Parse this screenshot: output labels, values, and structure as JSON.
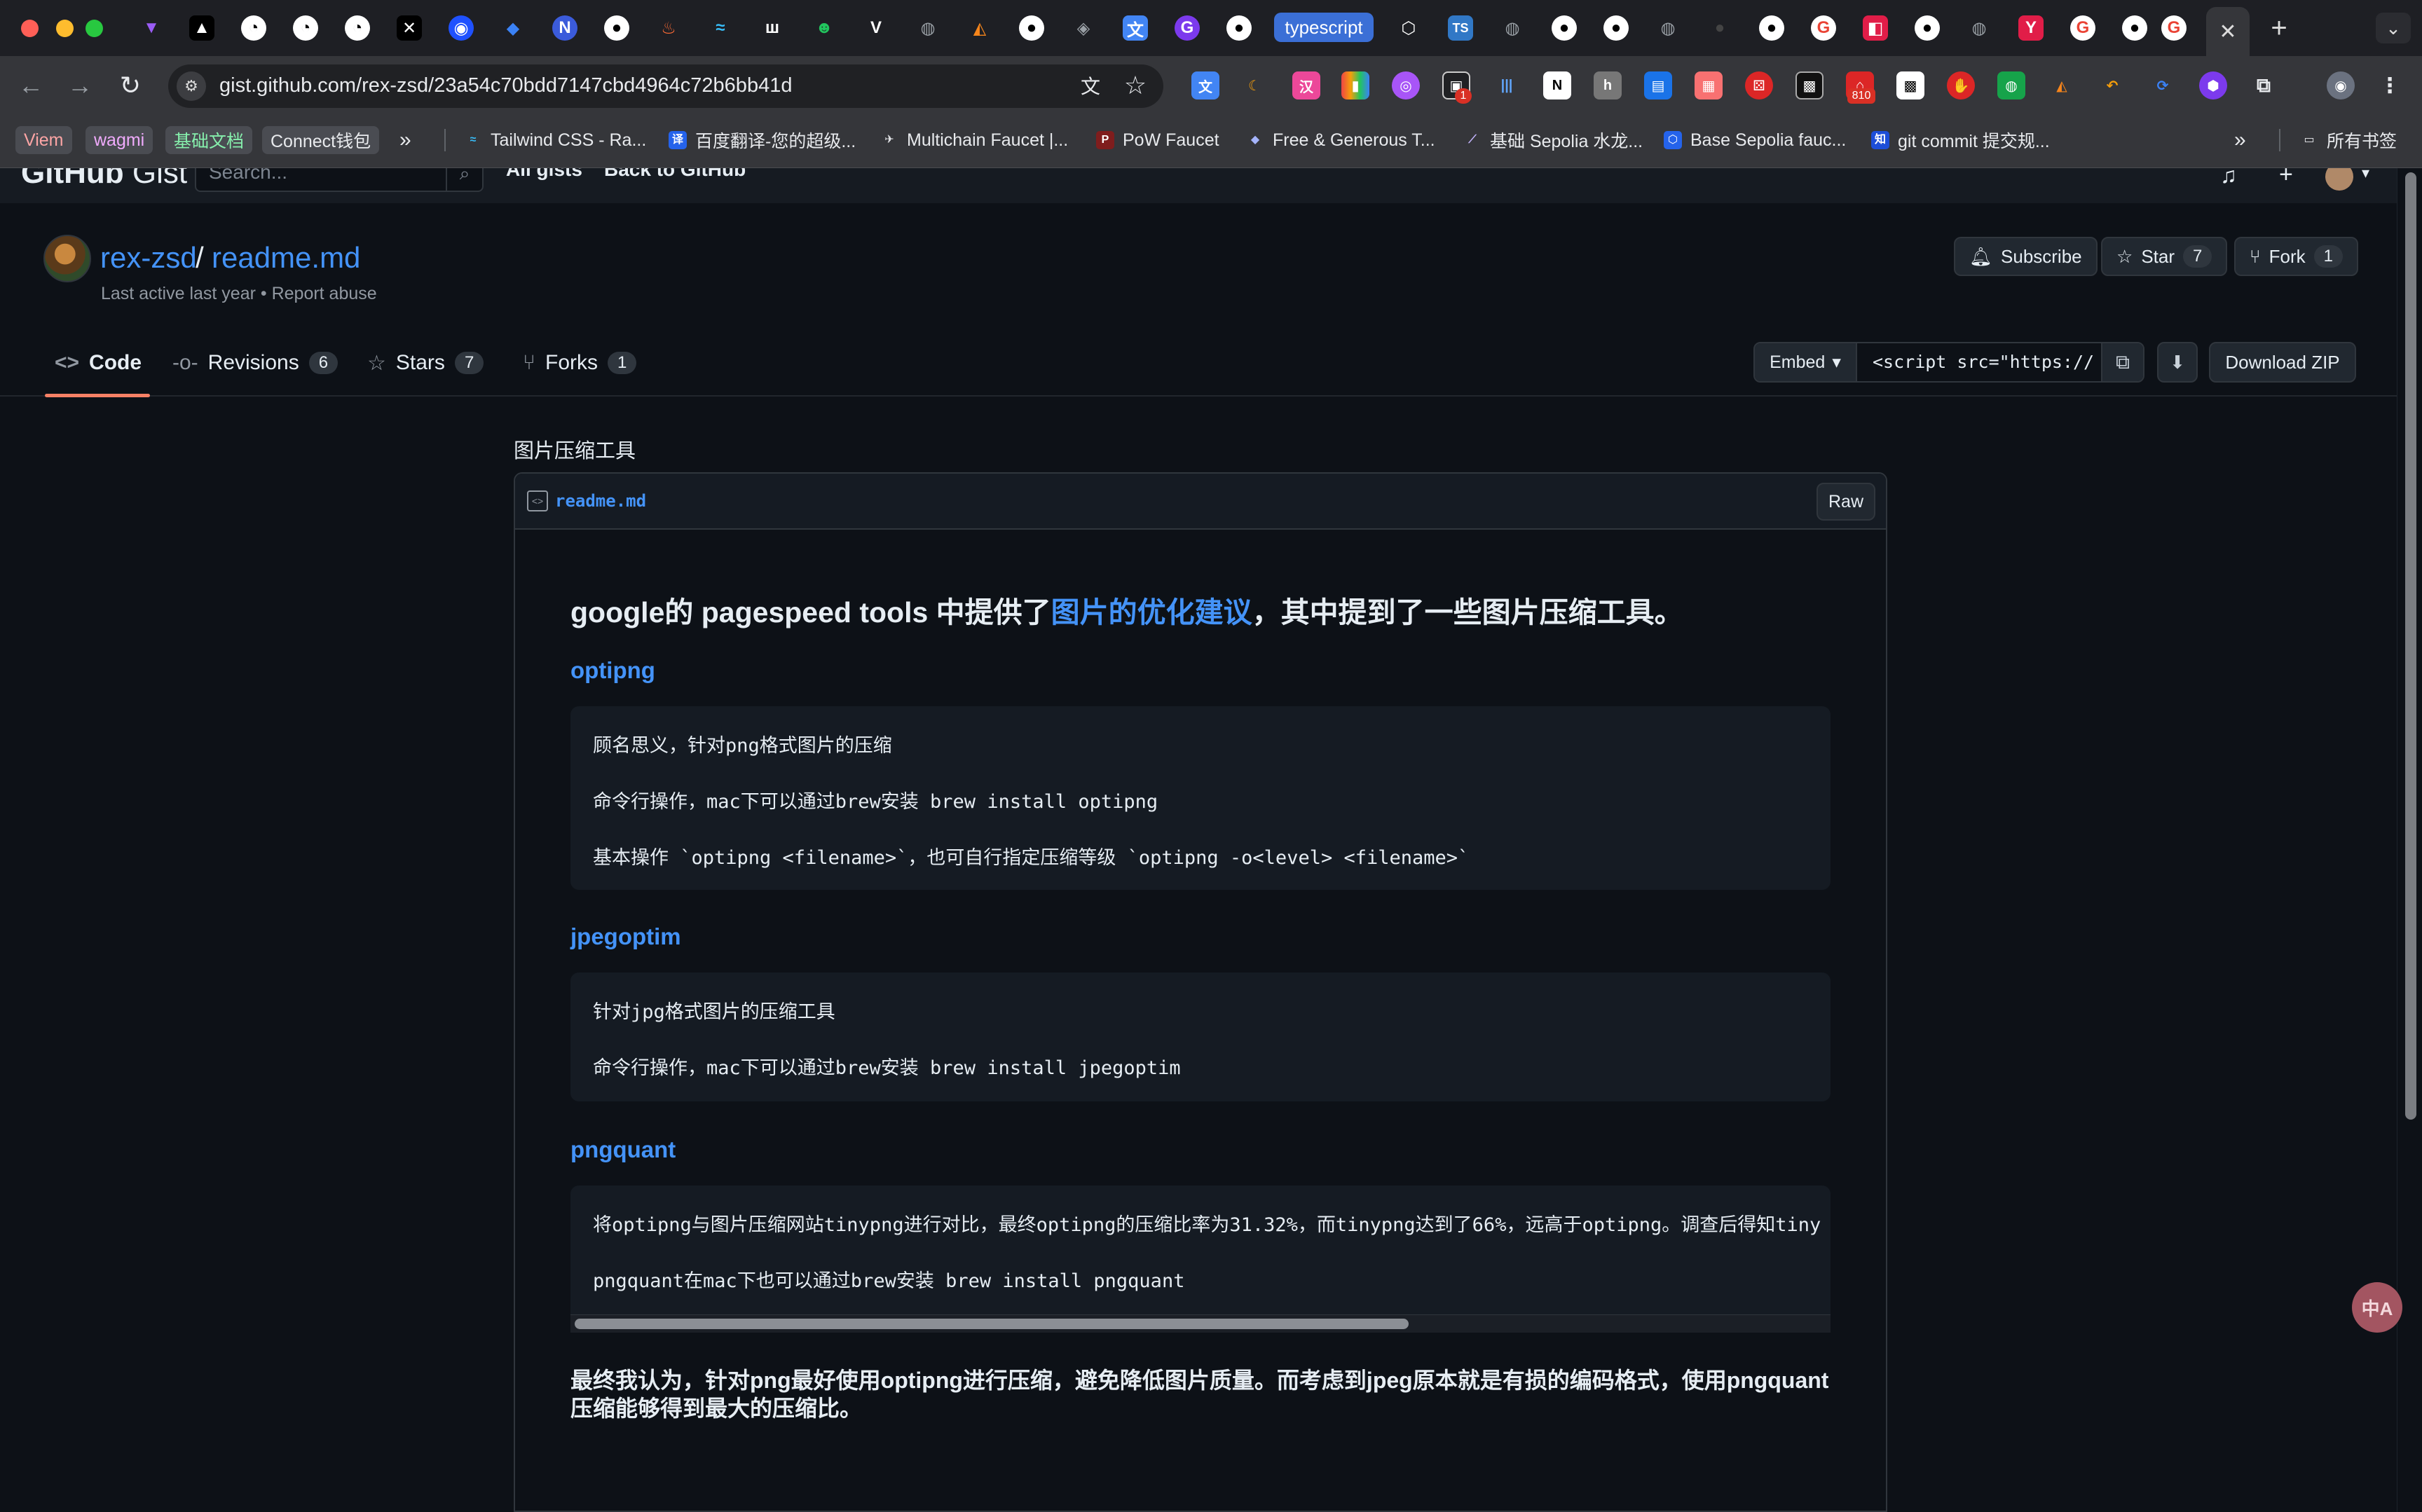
{
  "browser": {
    "pinned_tab_label": "typescript",
    "url": "gist.github.com/rex-zsd/23a54c70bdd7147cbd4964c72b6bb41d",
    "extension_badges": [
      "1",
      "810"
    ],
    "bookmarks": [
      "Viem",
      "wagmi",
      "基础文档",
      "Connect钱包",
      "Tailwind CSS - Ra...",
      "百度翻译-您的超级...",
      "Multichain Faucet |...",
      "PoW Faucet",
      "Free & Generous T...",
      "基础 Sepolia 水龙...",
      "Base Sepolia fauc...",
      "git commit 提交规..."
    ],
    "all_bookmarks_label": "所有书签"
  },
  "gist_header": {
    "logo_bold": "GitHub",
    "logo_light": "Gist",
    "search_placeholder": "Search...",
    "all_gists": "All gists",
    "back_to_github": "Back to GitHub"
  },
  "gist": {
    "owner": "rex-zsd",
    "separator": "/",
    "filename": "readme.md",
    "meta": "Last active last year • Report abuse",
    "subscribe": "Subscribe",
    "star": "Star",
    "star_count": "7",
    "fork": "Fork",
    "fork_count": "1"
  },
  "tabs": {
    "code": "Code",
    "revisions": "Revisions",
    "revisions_count": "6",
    "stars": "Stars",
    "stars_count": "7",
    "forks": "Forks",
    "forks_count": "1"
  },
  "actions": {
    "embed": "Embed",
    "embed_code": "<script src=\"https://",
    "download_zip": "Download ZIP"
  },
  "file": {
    "description": "图片压缩工具",
    "name": "readme.md",
    "raw": "Raw",
    "heading_prefix": "google的 pagespeed tools 中提供了",
    "heading_link": "图片的优化建议",
    "heading_suffix": "，其中提到了一些图片压缩工具。",
    "sections": [
      {
        "title": "optipng",
        "lines": [
          "顾名思义，针对png格式图片的压缩",
          "命令行操作，mac下可以通过brew安装 brew install optipng",
          "基本操作 `optipng <filename>`，也可自行指定压缩等级 `optipng -o<level> <filename>`"
        ]
      },
      {
        "title": "jpegoptim",
        "lines": [
          "针对jpg格式图片的压缩工具",
          "命令行操作，mac下可以通过brew安装 brew install jpegoptim"
        ]
      },
      {
        "title": "pngquant",
        "lines": [
          "将optipng与图片压缩网站tinypng进行对比，最终optipng的压缩比率为31.32%，而tinypng达到了66%，远高于optipng。调查后得知tiny",
          "pngquant在mac下也可以通过brew安装 brew install pngquant"
        ]
      }
    ],
    "conclusion": "最终我认为，针对png最好使用optipng进行压缩，避免降低图片质量。而考虑到jpeg原本就是有损的编码格式，使用pngquant压缩能够得到最大的压缩比。"
  },
  "floating": {
    "translate_label": "中A"
  },
  "colors": {
    "page_bg": "#0d1117",
    "link": "#4493f8",
    "tab_underline": "#f78166",
    "code_bg": "#151b23"
  }
}
